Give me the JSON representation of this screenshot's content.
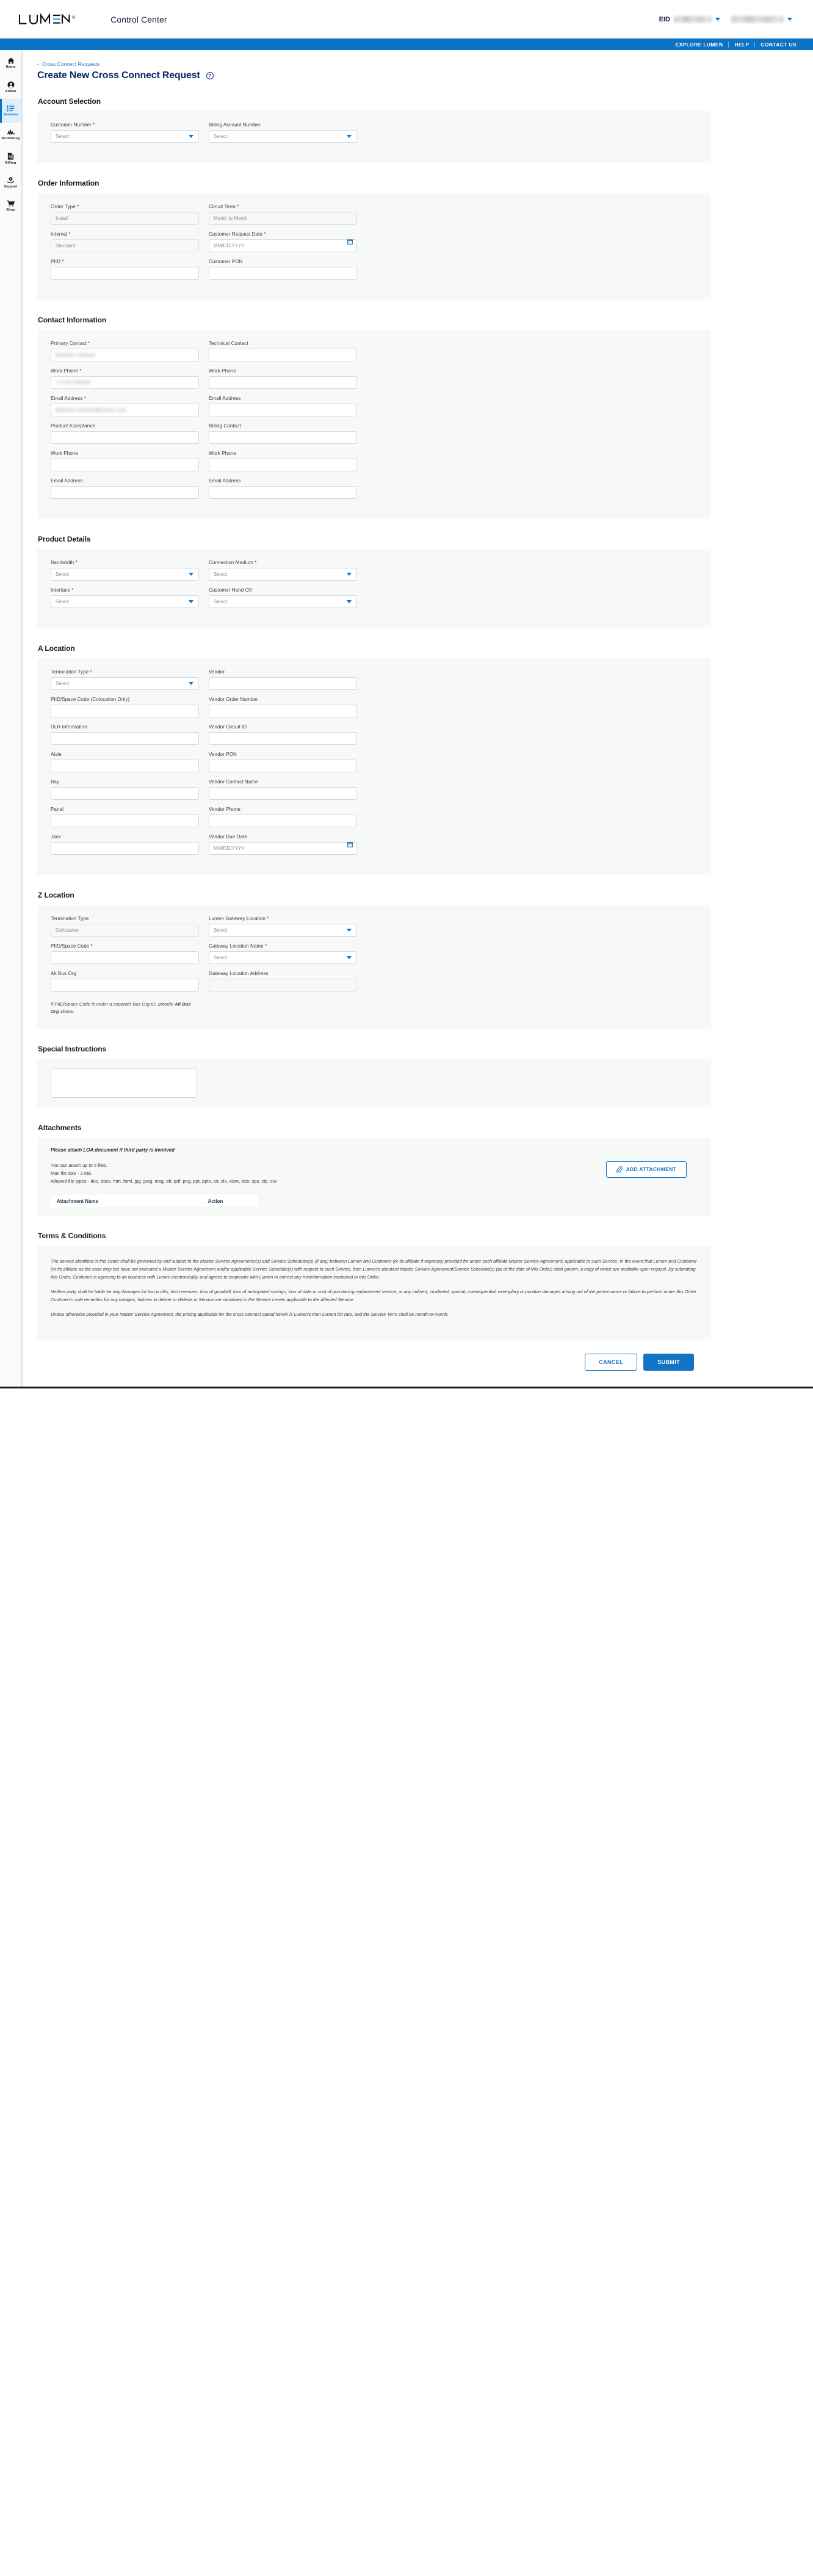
{
  "brand": {
    "logo_text": "LUMEN",
    "logo_registered": "®",
    "app_title": "Control Center",
    "eid_label": "EID",
    "eid_value_redacted": "",
    "account_value_redacted": ""
  },
  "topnav": {
    "items": [
      {
        "label": "EXPLORE LUMEN"
      },
      {
        "label": "HELP"
      },
      {
        "label": "CONTACT US"
      }
    ]
  },
  "sidebar": {
    "items": [
      {
        "label": "Home",
        "icon": "home-icon",
        "active": false
      },
      {
        "label": "Admin",
        "icon": "user-circle-icon",
        "active": false
      },
      {
        "label": "Services",
        "icon": "list-icon",
        "active": true
      },
      {
        "label": "Monitoring",
        "icon": "pulse-icon",
        "active": false
      },
      {
        "label": "Billing",
        "icon": "invoice-icon",
        "active": false
      },
      {
        "label": "Support",
        "icon": "support-gear-icon",
        "active": false
      },
      {
        "label": "Shop",
        "icon": "cart-icon",
        "active": false
      }
    ]
  },
  "page": {
    "breadcrumb": "Cross Connect Requests",
    "title": "Create New Cross Connect Request",
    "help_glyph": "?"
  },
  "sections": {
    "account_selection": {
      "title": "Account Selection",
      "fields": {
        "customer_number": {
          "label": "Customer Number",
          "required": true,
          "value": "Select",
          "type": "select"
        },
        "billing_account_number": {
          "label": "Billing Account Number",
          "required": false,
          "value": "Select",
          "type": "select"
        }
      }
    },
    "order_information": {
      "title": "Order Information",
      "fields": {
        "order_type": {
          "label": "Order Type",
          "required": true,
          "value": "Install",
          "type": "readonly"
        },
        "circuit_term": {
          "label": "Circuit Term",
          "required": true,
          "value": "Month to Month",
          "type": "readonly"
        },
        "interval": {
          "label": "Interval",
          "required": true,
          "value": "Standard",
          "type": "readonly"
        },
        "customer_request_date": {
          "label": "Customer Request Date",
          "required": true,
          "value": "MM/DD/YYYY",
          "type": "date"
        },
        "piid": {
          "label": "PIID",
          "required": true,
          "value": "",
          "type": "text"
        },
        "customer_pon": {
          "label": "Customer PON",
          "required": false,
          "value": "",
          "type": "text"
        }
      }
    },
    "contact_information": {
      "title": "Contact Information",
      "fields": {
        "primary_contact": {
          "label": "Primary Contact",
          "required": true,
          "value": "",
          "redacted": true
        },
        "technical_contact": {
          "label": "Technical Contact",
          "required": false,
          "value": ""
        },
        "primary_work_phone": {
          "label": "Work Phone",
          "required": true,
          "value": "",
          "redacted": true
        },
        "technical_work_phone": {
          "label": "Work Phone",
          "required": false,
          "value": ""
        },
        "primary_email": {
          "label": "Email Address",
          "required": true,
          "value": "",
          "redacted": true
        },
        "technical_email": {
          "label": "Email Address",
          "required": false,
          "value": ""
        },
        "product_acceptance": {
          "label": "Product Acceptance",
          "required": false,
          "value": ""
        },
        "billing_contact": {
          "label": "Billing Contact",
          "required": false,
          "value": ""
        },
        "product_work_phone": {
          "label": "Work Phone",
          "required": false,
          "value": ""
        },
        "billing_work_phone": {
          "label": "Work Phone",
          "required": false,
          "value": ""
        },
        "product_email": {
          "label": "Email Address",
          "required": false,
          "value": ""
        },
        "billing_email": {
          "label": "Email Address",
          "required": false,
          "value": ""
        }
      }
    },
    "product_details": {
      "title": "Product Details",
      "fields": {
        "bandwidth": {
          "label": "Bandwidth",
          "required": true,
          "value": "Select",
          "type": "select"
        },
        "connection_medium": {
          "label": "Connection Medium",
          "required": true,
          "value": "Select",
          "type": "select"
        },
        "interface": {
          "label": "Interface",
          "required": true,
          "value": "Select",
          "type": "select"
        },
        "customer_hand_off": {
          "label": "Customer Hand Off",
          "required": false,
          "value": "Select",
          "type": "select"
        }
      }
    },
    "a_location": {
      "title": "A Location",
      "fields": {
        "termination_type": {
          "label": "Termination Type",
          "required": true,
          "value": "Select",
          "type": "select"
        },
        "vendor": {
          "label": "Vendor",
          "required": false,
          "value": ""
        },
        "piid_space_code": {
          "label": "PIID/Space Code (Colocation Only)",
          "required": false,
          "value": ""
        },
        "vendor_order_number": {
          "label": "Vendor Order Number",
          "required": false,
          "value": ""
        },
        "dlr_information": {
          "label": "DLR Information",
          "required": false,
          "value": ""
        },
        "vendor_circuit_id": {
          "label": "Vendor Circuit ID",
          "required": false,
          "value": ""
        },
        "aisle": {
          "label": "Aisle",
          "required": false,
          "value": ""
        },
        "vendor_pon": {
          "label": "Vendor PON",
          "required": false,
          "value": ""
        },
        "bay": {
          "label": "Bay",
          "required": false,
          "value": ""
        },
        "vendor_contact_name": {
          "label": "Vendor Contact Name",
          "required": false,
          "value": ""
        },
        "panel": {
          "label": "Panel",
          "required": false,
          "value": ""
        },
        "vendor_phone": {
          "label": "Vendor Phone",
          "required": false,
          "value": ""
        },
        "jack": {
          "label": "Jack",
          "required": false,
          "value": ""
        },
        "vendor_due_date": {
          "label": "Vendor Due Date",
          "required": false,
          "value": "MM/DD/YYYY",
          "type": "date"
        }
      }
    },
    "z_location": {
      "title": "Z Location",
      "fields": {
        "termination_type": {
          "label": "Termination Type",
          "required": false,
          "value": "Colocation",
          "type": "readonly"
        },
        "lumen_gateway_location": {
          "label": "Lumen Gateway Location",
          "required": true,
          "value": "Select",
          "type": "select"
        },
        "piid_space_code": {
          "label": "PIID/Space Code",
          "required": true,
          "value": ""
        },
        "gateway_location_name": {
          "label": "Gateway Location Name",
          "required": true,
          "value": "Select",
          "type": "select"
        },
        "alt_bus_org": {
          "label": "Alt Bus Org",
          "required": false,
          "value": ""
        },
        "gateway_location_address": {
          "label": "Gateway Location Address",
          "required": false,
          "value": "",
          "type": "disabled"
        }
      },
      "note_prefix": "If PIID/Space Code is under a separate Bus Org ID, provide ",
      "note_bold": "Alt Bus Org",
      "note_suffix": " above."
    },
    "special_instructions": {
      "title": "Special Instructions",
      "textarea_value": ""
    },
    "attachments": {
      "title": "Attachments",
      "loa_note": "Please attach LOA document if third party is involved",
      "line1": "You can attach up to 5 files.",
      "line2": "Max file size - 2 MB.",
      "line3": "Allowed file types - doc, docx, htm, html, jpg, jpeg, msg, oft, pdf, png, ppt, pptx, txt, xls, xlsm, xlsx, xps, zip, csv",
      "add_button": "ADD ATTACHMENT",
      "table": {
        "columns": [
          "Attachment Name",
          "Action"
        ],
        "rows": []
      }
    },
    "terms": {
      "title": "Terms & Conditions",
      "paragraphs": [
        "The service identified in this Order shall be governed by and subject to the Master Service Agreements(s) and Service Schedules(s) (if any) between Lumen and Customer (or its affiliate if expressly provided for under such affiliate Master Service Agreement) applicable to such Service. In the event that Lumen and Customer (or its affiliate as the case may be) have not executed a Master Service Agreement and/or applicable Service Schedule(s) with respect to such Service, then Lumen's standard Master Service Agreement/Service Schedule(s) (as of the date of this Order) shall govern, a copy of which are available upon request. By submitting this Order, Customer is agreeing to do business with Lumen electronically, and agrees to cooperate with Lumen to correct any misinformation contained in this Order.",
        "Neither party shall be liable for any damages for lost profits, lost revenues, loss of goodwill, loss of anticipated savings, loss of data or cost of purchasing replacement service, or any indirect, incidental, special, consequential, exemplary or punitive damages arising out of the performance or failure to perform under this Order. Customer's sole remedies for any outages, failures to deliver or defects in Service are contained in the Service Levels applicable to the affected Service.",
        "Unless otherwise provided in your Master Service Agreement, the pricing applicable for the cross connect stated herein is Lumen's then current list rate, and the Service Term shall be month-to-month."
      ]
    }
  },
  "footer": {
    "cancel": "CANCEL",
    "submit": "SUBMIT"
  },
  "colors": {
    "brand_blue": "#0b72c4",
    "title_navy": "#0c2c6b",
    "required_red": "#d0021b",
    "panel_bg": "#f7f8f8",
    "active_nav_bg": "#ddeeff"
  }
}
